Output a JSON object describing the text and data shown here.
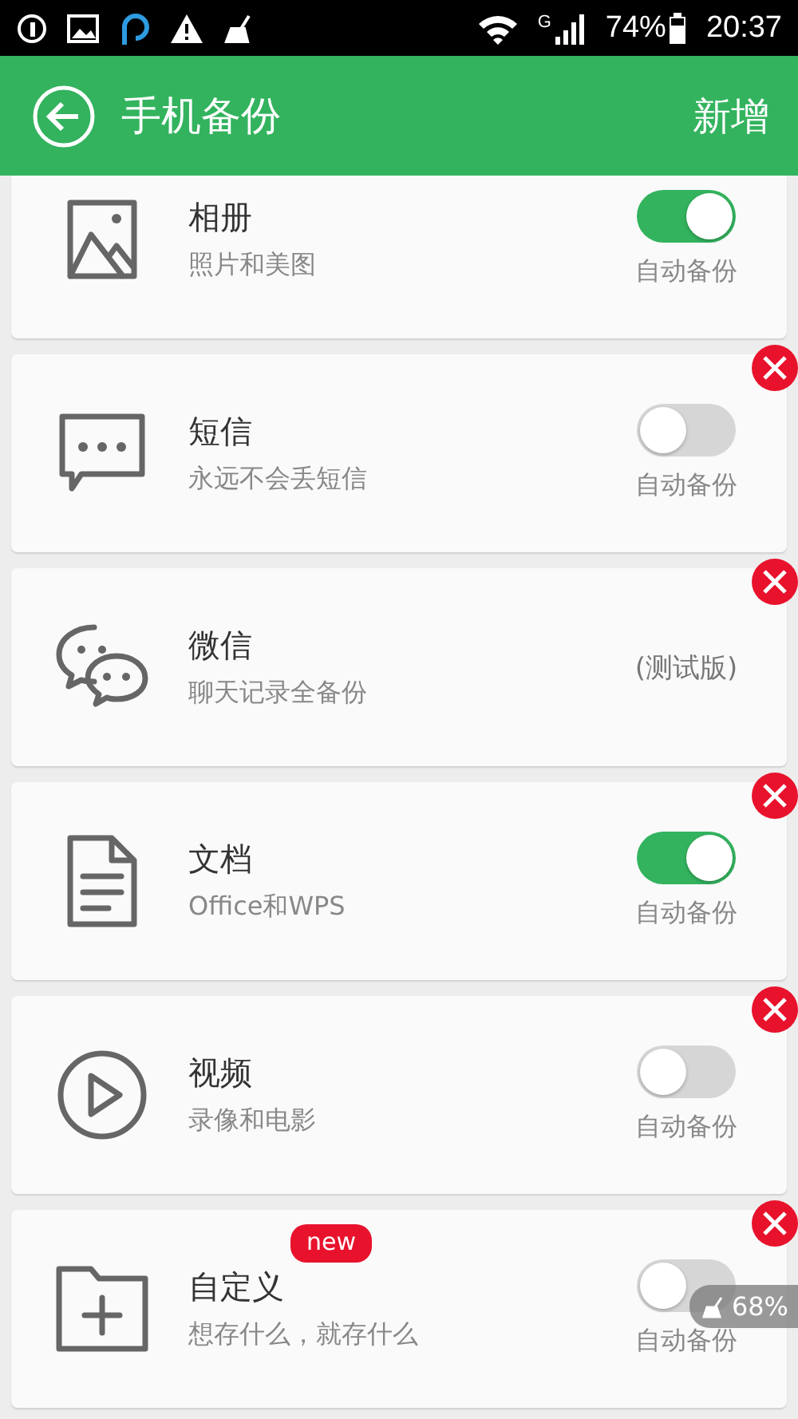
{
  "status_bar": {
    "network": "G",
    "battery": "74%",
    "time": "20:37"
  },
  "app_bar": {
    "title": "手机备份",
    "action": "新增"
  },
  "items": [
    {
      "title": "相册",
      "subtitle": "照片和美图",
      "kind": "toggle",
      "on": true,
      "label": "自动备份",
      "removable": false
    },
    {
      "title": "短信",
      "subtitle": "永远不会丢短信",
      "kind": "toggle",
      "on": false,
      "label": "自动备份",
      "removable": true
    },
    {
      "title": "微信",
      "subtitle": "聊天记录全备份",
      "kind": "note",
      "note": "(测试版)",
      "removable": true
    },
    {
      "title": "文档",
      "subtitle": "Office和WPS",
      "kind": "toggle",
      "on": true,
      "label": "自动备份",
      "removable": true
    },
    {
      "title": "视频",
      "subtitle": "录像和电影",
      "kind": "toggle",
      "on": false,
      "label": "自动备份",
      "removable": true
    },
    {
      "title": "自定义",
      "badge": "new",
      "subtitle": "想存什么，就存什么",
      "kind": "toggle",
      "on": false,
      "label": "自动备份",
      "removable": true
    }
  ],
  "floating_widget": {
    "text": "68%"
  }
}
